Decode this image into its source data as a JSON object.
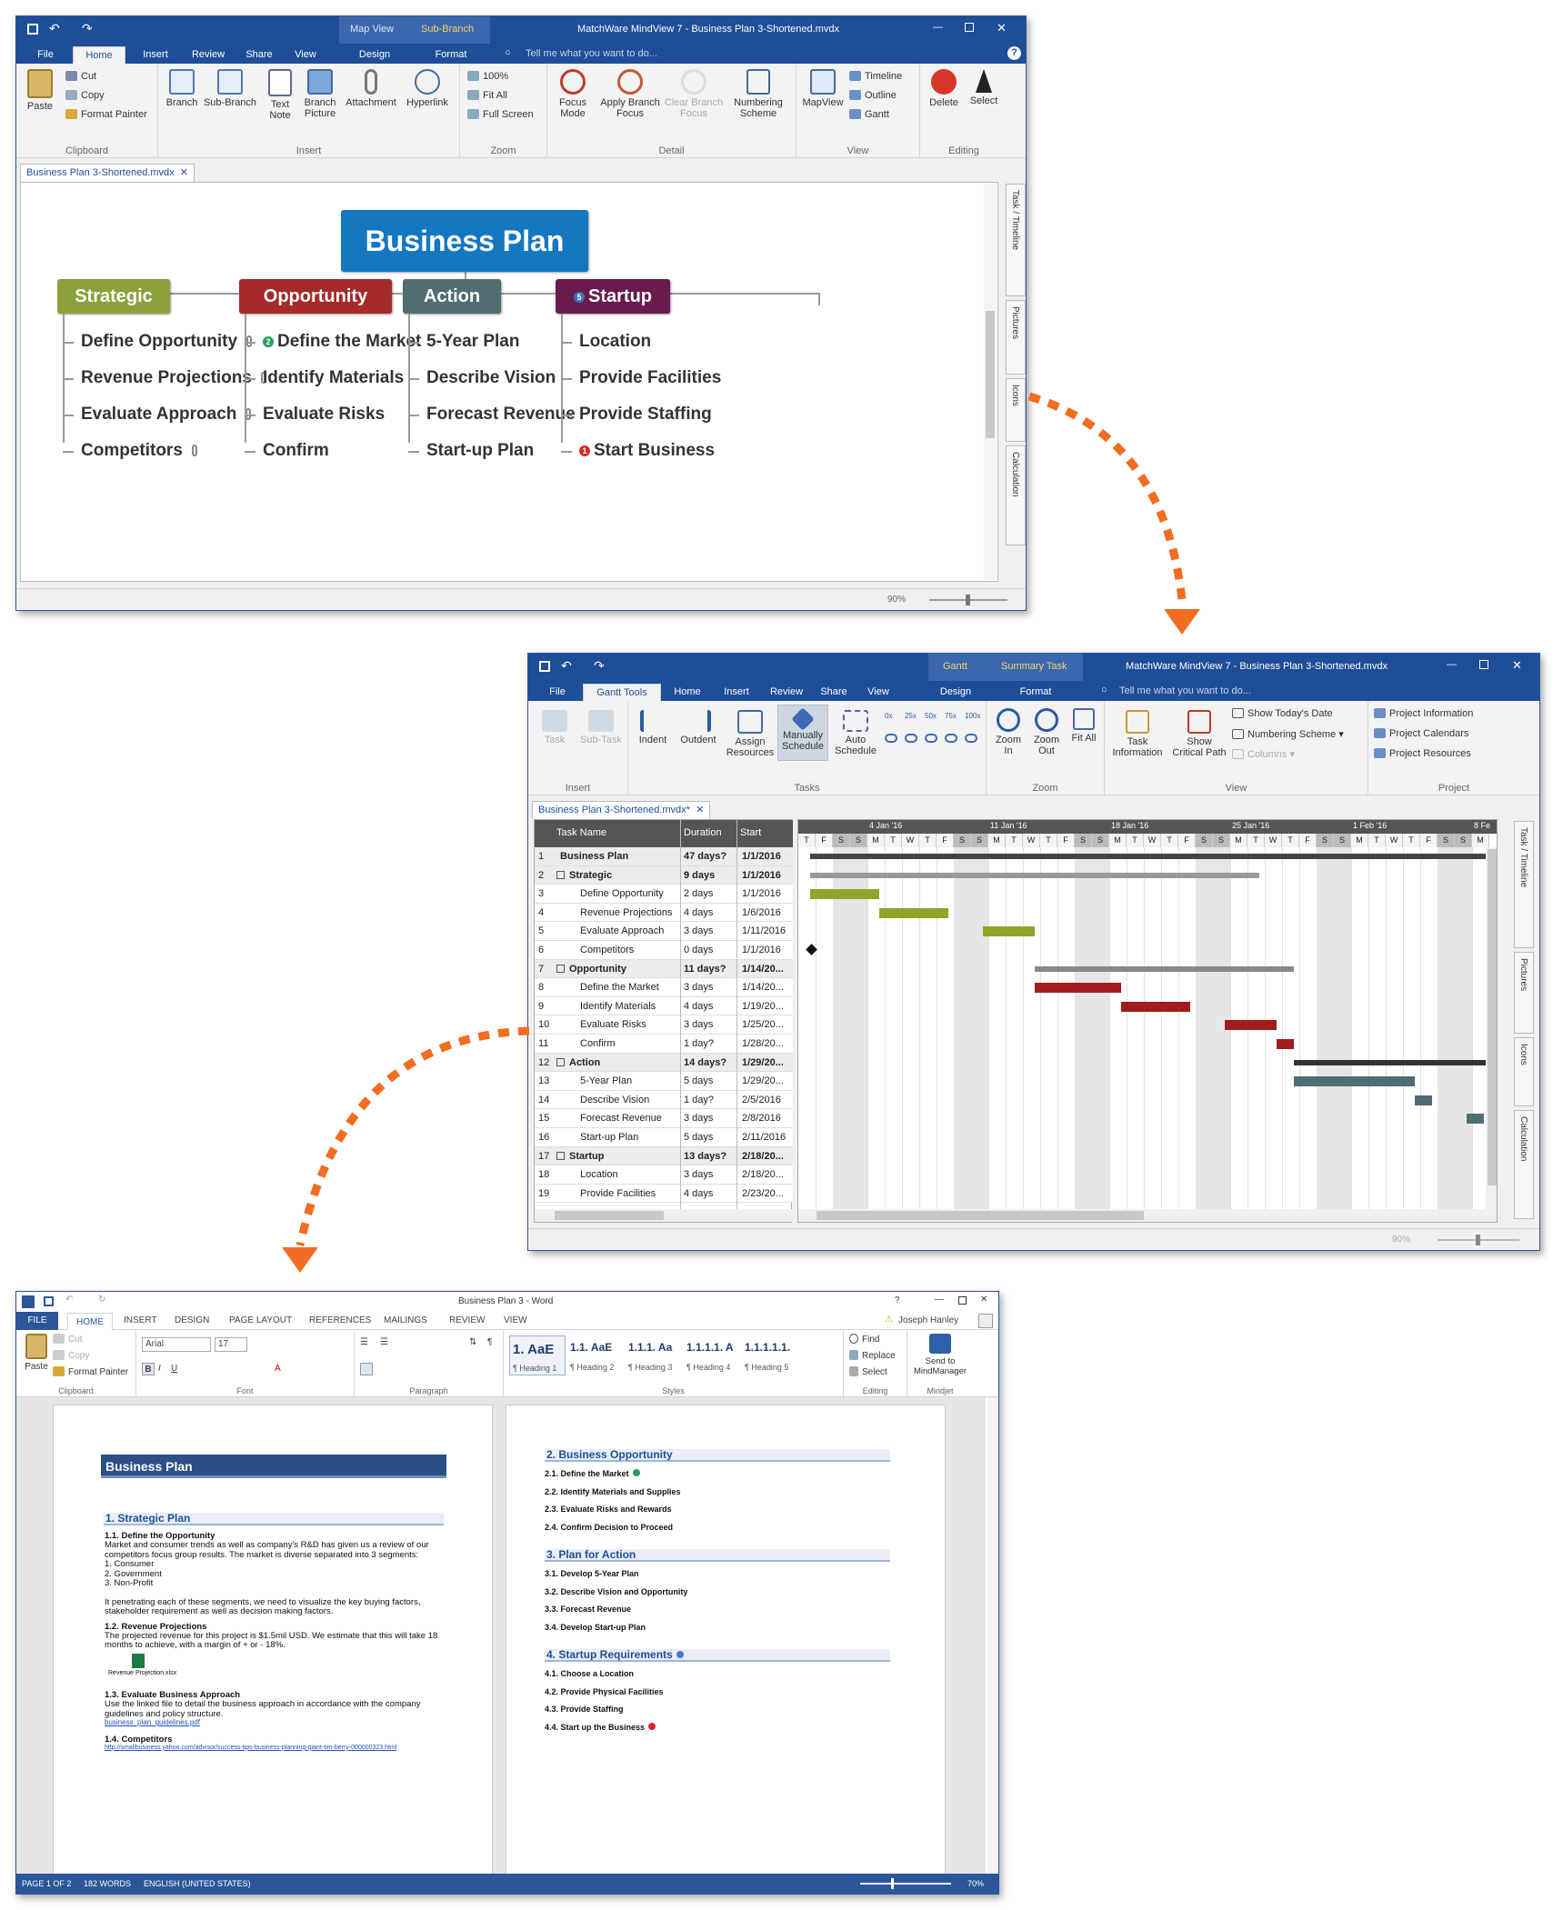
{
  "mindview_map": {
    "title": "MatchWare MindView 7 - Business Plan 3-Shortened.mvdx",
    "context_tabs": [
      "Map View",
      "Sub-Branch"
    ],
    "tabs": [
      "File",
      "Home",
      "Insert",
      "Review",
      "Share",
      "View",
      "Design",
      "Format"
    ],
    "tell_me": "Tell me what you want to do...",
    "clipboard": {
      "paste": "Paste",
      "cut": "Cut",
      "copy": "Copy",
      "format_painter": "Format Painter",
      "label": "Clipboard"
    },
    "insert": {
      "branch": "Branch",
      "sub_branch": "Sub-Branch",
      "text_note": "Text Note",
      "branch_picture": "Branch Picture",
      "attachment": "Attachment",
      "hyperlink": "Hyperlink",
      "label": "Insert"
    },
    "zoom": {
      "pct": "100%",
      "fit_all": "Fit All",
      "full_screen": "Full Screen",
      "label": "Zoom"
    },
    "detail": {
      "focus_mode": "Focus Mode",
      "apply_branch_focus": "Apply Branch Focus",
      "clear_branch_focus": "Clear Branch Focus",
      "numbering_scheme": "Numbering Scheme",
      "label": "Detail"
    },
    "view": {
      "mapview": "MapView",
      "timeline": "Timeline",
      "outline": "Outline",
      "gantt": "Gantt",
      "label": "View"
    },
    "editing": {
      "delete": "Delete",
      "select": "Select",
      "label": "Editing"
    },
    "doc_tab": "Business Plan 3-Shortened.mvdx",
    "side_panels": [
      "Task / Timeline",
      "Pictures",
      "Icons",
      "Calculation"
    ],
    "zoom_level": "90%",
    "root": "Business Plan",
    "branches": [
      {
        "label": "Strategic",
        "color": "#8aa13a",
        "children": [
          "Define Opportunity",
          "Revenue Projections",
          "Evaluate Approach",
          "Competitors"
        ]
      },
      {
        "label": "Opportunity",
        "color": "#a52a2a",
        "children": [
          "Define the Market",
          "Identify Materials",
          "Evaluate Risks",
          "Confirm"
        ]
      },
      {
        "label": "Action",
        "color": "#4f6d73",
        "children": [
          "5-Year  Plan",
          "Describe Vision",
          "Forecast Revenue",
          "Start-up Plan"
        ]
      },
      {
        "label": "Startup",
        "color": "#6a1b4d",
        "children": [
          "Location",
          "Provide Facilities",
          "Provide Staffing",
          "Start Business"
        ]
      }
    ],
    "badges": {
      "priority": "2",
      "startup_num": "5",
      "alert": "1"
    }
  },
  "mindview_gantt": {
    "title": "MatchWare MindView 7 - Business Plan 3-Shortened.mvdx",
    "context_tabs": [
      "Gantt",
      "Summary Task"
    ],
    "tabs": [
      "File",
      "Gantt Tools",
      "Home",
      "Insert",
      "Review",
      "Share",
      "View",
      "Design",
      "Format"
    ],
    "tell_me": "Tell me what you want to do...",
    "insert": {
      "task": "Task",
      "sub_task": "Sub-Task",
      "label": "Insert"
    },
    "tasks": {
      "indent": "Indent",
      "outdent": "Outdent",
      "assign_resources": "Assign Resources",
      "manually_schedule": "Manually Schedule",
      "auto_schedule": "Auto Schedule",
      "label": "Tasks",
      "pcts": [
        "0x",
        "25x",
        "50x",
        "75x",
        "100x"
      ]
    },
    "zoom": {
      "zoom_in": "Zoom In",
      "zoom_out": "Zoom Out",
      "fit_all": "Fit All",
      "label": "Zoom"
    },
    "view": {
      "task_information": "Task Information",
      "critical_path": "Show Critical Path",
      "show_today": "Show Today's Date",
      "numbering": "Numbering Scheme",
      "columns": "Columns",
      "label": "View"
    },
    "project": {
      "information": "Project Information",
      "calendars": "Project Calendars",
      "resources": "Project Resources",
      "label": "Project"
    },
    "doc_tab": "Business Plan 3-Shortened.mvdx*",
    "side_panels": [
      "Task / Timeline",
      "Pictures",
      "Icons",
      "Calculation"
    ],
    "zoom_level": "90%",
    "columns": [
      "Task Name",
      "Duration",
      "Start"
    ],
    "weeks": [
      "4 Jan '16",
      "11 Jan '16",
      "18 Jan '16",
      "25 Jan '16",
      "1 Feb '16",
      "8 Fe"
    ],
    "days": [
      "T",
      "F",
      "S",
      "S",
      "M",
      "T",
      "W",
      "T",
      "F",
      "S",
      "S",
      "M",
      "T",
      "W",
      "T",
      "F",
      "S",
      "S",
      "M",
      "T",
      "W",
      "T",
      "F",
      "S",
      "S",
      "M",
      "T",
      "W",
      "T",
      "F",
      "S",
      "S",
      "M",
      "T",
      "W",
      "T",
      "F",
      "S",
      "S",
      "M"
    ],
    "rows": [
      {
        "n": "1",
        "name": "Business Plan",
        "dur": "47 days?",
        "start": "1/1/2016",
        "level": 0,
        "summary": true
      },
      {
        "n": "2",
        "name": "Strategic",
        "dur": "9 days",
        "start": "1/1/2016",
        "level": 1,
        "summary": true
      },
      {
        "n": "3",
        "name": "Define Opportunity",
        "dur": "2 days",
        "start": "1/1/2016",
        "level": 2
      },
      {
        "n": "4",
        "name": "Revenue Projections",
        "dur": "4 days",
        "start": "1/6/2016",
        "level": 2
      },
      {
        "n": "5",
        "name": "Evaluate Approach",
        "dur": "3 days",
        "start": "1/11/2016",
        "level": 2
      },
      {
        "n": "6",
        "name": "Competitors",
        "dur": "0 days",
        "start": "1/1/2016",
        "level": 2
      },
      {
        "n": "7",
        "name": "Opportunity",
        "dur": "11 days?",
        "start": "1/14/20...",
        "level": 1,
        "summary": true
      },
      {
        "n": "8",
        "name": "Define the Market",
        "dur": "3 days",
        "start": "1/14/20...",
        "level": 2
      },
      {
        "n": "9",
        "name": "Identify Materials",
        "dur": "4 days",
        "start": "1/19/20...",
        "level": 2
      },
      {
        "n": "10",
        "name": "Evaluate Risks",
        "dur": "3 days",
        "start": "1/25/20...",
        "level": 2
      },
      {
        "n": "11",
        "name": "Confirm",
        "dur": "1 day?",
        "start": "1/28/20...",
        "level": 2
      },
      {
        "n": "12",
        "name": "Action",
        "dur": "14 days?",
        "start": "1/29/20...",
        "level": 1,
        "summary": true
      },
      {
        "n": "13",
        "name": "5-Year  Plan",
        "dur": "5 days",
        "start": "1/29/20...",
        "level": 2
      },
      {
        "n": "14",
        "name": "Describe Vision",
        "dur": "1 day?",
        "start": "2/5/2016",
        "level": 2
      },
      {
        "n": "15",
        "name": "Forecast Revenue",
        "dur": "3 days",
        "start": "2/8/2016",
        "level": 2
      },
      {
        "n": "16",
        "name": "Start-up Plan",
        "dur": "5 days",
        "start": "2/11/2016",
        "level": 2
      },
      {
        "n": "17",
        "name": "Startup",
        "dur": "13 days?",
        "start": "2/18/20...",
        "level": 1,
        "summary": true
      },
      {
        "n": "18",
        "name": "Location",
        "dur": "3 days",
        "start": "2/18/20...",
        "level": 2
      },
      {
        "n": "19",
        "name": "Provide Facilities",
        "dur": "4 days",
        "start": "2/23/20...",
        "level": 2
      }
    ]
  },
  "word": {
    "title": "Business Plan 3 - Word",
    "tabs": [
      "FILE",
      "HOME",
      "INSERT",
      "DESIGN",
      "PAGE LAYOUT",
      "REFERENCES",
      "MAILINGS",
      "REVIEW",
      "VIEW"
    ],
    "user": "Joseph Hanley",
    "clipboard": {
      "paste": "Paste",
      "cut": "Cut",
      "copy": "Copy",
      "format_painter": "Format Painter",
      "label": "Clipboard"
    },
    "font": {
      "name": "Arial",
      "size": "17",
      "label": "Font"
    },
    "paragraph_label": "Paragraph",
    "styles": [
      {
        "sample": "1. AaE",
        "name": "¶ Heading 1"
      },
      {
        "sample": "1.1. AaE",
        "name": "¶ Heading 2"
      },
      {
        "sample": "1.1.1. Aa",
        "name": "¶ Heading 3"
      },
      {
        "sample": "1.1.1.1. A",
        "name": "¶ Heading 4"
      },
      {
        "sample": "1.1.1.1.1.",
        "name": "¶ Heading 5"
      }
    ],
    "styles_label": "Styles",
    "editing": {
      "find": "Find",
      "replace": "Replace",
      "select": "Select",
      "label": "Editing"
    },
    "mindjet": {
      "send": "Send to MindManager",
      "label": "Mindjet"
    },
    "page1": {
      "title": "Business Plan",
      "h1": "1. Strategic Plan",
      "s11": "1.1. Define the Opportunity",
      "p11": [
        "Market and consumer trends as well as company's R&D has given us a review of our",
        "competitors focus group results. The market is diverse separated into 3 segments:",
        "1. Consumer",
        "2. Government",
        "3. Non-Profit",
        "",
        "It penetrating each of these segments, we need to visualize the key buying factors,",
        "stakeholder requirement as well as decision making factors."
      ],
      "s12": "1.2. Revenue Projections",
      "p12": [
        "The projected revenue for this project is $1.5mil USD. We estimate that this will take 18",
        "months to achieve, with a margin of + or - 18%."
      ],
      "xls": "Revenue Projection.xlsx",
      "s13": "1.3. Evaluate Business Approach",
      "p13": [
        "Use the linked file to detail the business approach in accordance with the company",
        "guidelines and policy structure."
      ],
      "link13": "business_plan_guidelines.pdf",
      "s14": "1.4. Competitors",
      "link14": "http://smallbusiness.yahoo.com/advisor/success-tips-business-planning-giant-tim-berry-000000323.html"
    },
    "page2": {
      "sections": [
        {
          "h": "2. Business Opportunity",
          "items": [
            "2.1. Define the Market",
            "2.2. Identify Materials and Supplies",
            "2.3. Evaluate Risks and Rewards",
            "2.4. Confirm Decision to Proceed"
          ]
        },
        {
          "h": "3. Plan for Action",
          "items": [
            "3.1. Develop 5-Year  Plan",
            "3.2. Describe Vision and Opportunity",
            "3.3. Forecast Revenue",
            "3.4. Develop Start-up Plan"
          ]
        },
        {
          "h": "4. Startup Requirements",
          "items": [
            "4.1. Choose a Location",
            "4.2. Provide Physical Facilities",
            "4.3. Provide Staffing",
            "4.4. Start up the Business"
          ]
        }
      ]
    },
    "status": {
      "page": "PAGE 1 OF 2",
      "words": "182 WORDS",
      "lang": "ENGLISH (UNITED STATES)",
      "zoom": "70%"
    }
  }
}
